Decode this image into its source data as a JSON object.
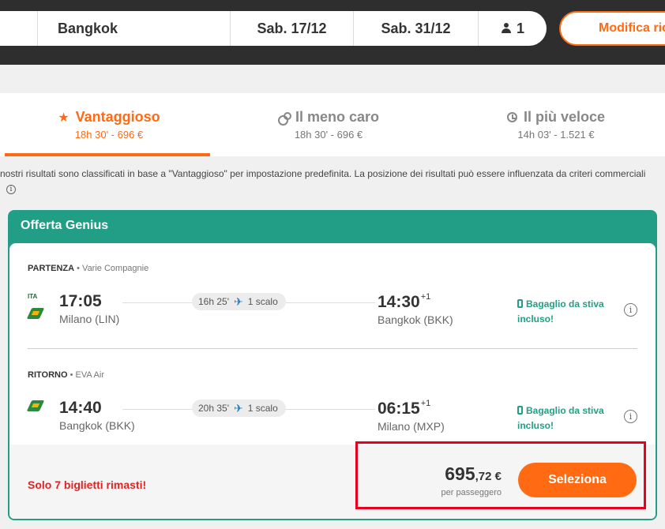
{
  "search": {
    "destination": "Bangkok",
    "depart_date": "Sab. 17/12",
    "return_date": "Sab. 31/12",
    "passengers": "1",
    "modify_label": "Modifica ric"
  },
  "tabs": [
    {
      "label": "Vantaggioso",
      "sub": "18h 30' - 696 €",
      "icon": "star-icon",
      "active": true
    },
    {
      "label": "Il meno caro",
      "sub": "18h 30' - 696 €",
      "icon": "coins-icon",
      "active": false
    },
    {
      "label": "Il più veloce",
      "sub": "14h 03' - 1.521 €",
      "icon": "clock-icon",
      "active": false
    }
  ],
  "disclaimer": "nostri risultati sono classificati in base a \"Vantaggioso\" per impostazione predefinita. La posizione dei risultati può essere influenzata da criteri commerciali",
  "offer": {
    "badge": "Offerta Genius",
    "legs": [
      {
        "label": "PARTENZA",
        "carrier": "• Varie Compagnie",
        "airline_logos": [
          "ITA",
          "EVA"
        ],
        "dep_time": "17:05",
        "dep_place": "Milano (LIN)",
        "duration": "16h 25'",
        "stops": "1 scalo",
        "arr_time": "14:30",
        "arr_offset": "+1",
        "arr_place": "Bangkok (BKK)",
        "baggage_line1": "Bagaglio da stiva",
        "baggage_line2": "incluso!"
      },
      {
        "label": "RITORNO",
        "carrier": "• EVA Air",
        "airline_logos": [
          "EVA"
        ],
        "dep_time": "14:40",
        "dep_place": "Bangkok (BKK)",
        "duration": "20h 35'",
        "stops": "1 scalo",
        "arr_time": "06:15",
        "arr_offset": "+1",
        "arr_place": "Milano (MXP)",
        "baggage_line1": "Bagaglio da stiva",
        "baggage_line2": "incluso!"
      }
    ],
    "warning": "Solo 7 biglietti rimasti!",
    "price_int": "695",
    "price_dec": ",72 €",
    "price_per": "per passeggero",
    "select_label": "Seleziona"
  },
  "colors": {
    "accent": "#ff6a13",
    "genius_green": "#229e86",
    "warning_red": "#e02424",
    "highlight_box": "#e8001c"
  }
}
